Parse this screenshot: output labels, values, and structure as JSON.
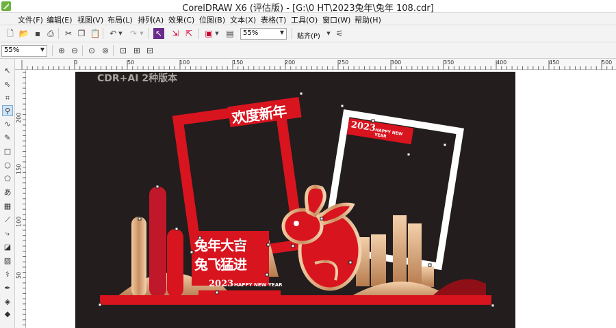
{
  "window": {
    "title": "CorelDRAW X6 (评估版) - [G:\\0 HT\\2023兔年\\兔年 108.cdr]"
  },
  "menu": [
    "文件(F)",
    "编辑(E)",
    "视图(V)",
    "布局(L)",
    "排列(A)",
    "效果(C)",
    "位图(B)",
    "文本(X)",
    "表格(T)",
    "工具(O)",
    "窗口(W)",
    "帮助(H)"
  ],
  "toolbar": {
    "zoom_value": "55%",
    "snap_label": "贴齐(P)"
  },
  "property_bar": {
    "zoom_value": "55%"
  },
  "rulers": {
    "corner_label": "%",
    "h_labels": [
      "0",
      "50",
      "100",
      "150",
      "200",
      "250",
      "300",
      "350",
      "400",
      "450",
      "500"
    ],
    "v_labels": [
      "200",
      "150",
      "100",
      "50"
    ]
  },
  "artwork": {
    "watermark": "CDR+AI 2种版本",
    "banner_title": "欢度新年",
    "tag_year": "2023",
    "tag_happy": "HAPPY NEW YEAR",
    "slogan_line1": "兔年大吉",
    "slogan_line2": "兔飞猛进",
    "footer_year": "2023",
    "footer_happy": "HAPPY NEW YEAR"
  },
  "colors": {
    "background": "#231d1d",
    "red": "#d8141f",
    "gold": "#e3b58a",
    "darkred": "#8e1016"
  }
}
